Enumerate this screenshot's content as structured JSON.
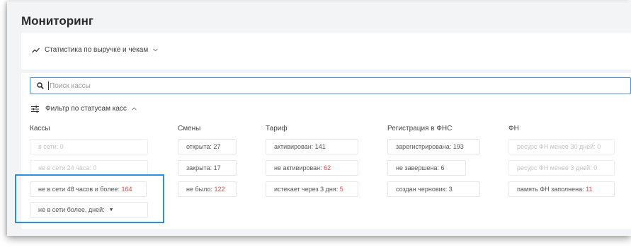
{
  "page": {
    "title": "Мониторинг"
  },
  "stats": {
    "label": "Статистика по выручке и чекам"
  },
  "search": {
    "placeholder": "Поиск кассы"
  },
  "filter": {
    "label": "Фильтр по статусам касс"
  },
  "columns": {
    "kassy": {
      "title": "Кассы",
      "online": {
        "label": "в сети:",
        "value": "0"
      },
      "offline24": {
        "label": "не в сети 24 часа:",
        "value": "0"
      },
      "offline48": {
        "label": "не в сети 48 часов и более:",
        "value": "164"
      },
      "offlineDays": {
        "label": "не в сети более, дней:"
      }
    },
    "smeny": {
      "title": "Смены",
      "opened": {
        "label": "открыта:",
        "value": "27"
      },
      "closed": {
        "label": "закрыта:",
        "value": "17"
      },
      "none": {
        "label": "не было:",
        "value": "122"
      }
    },
    "tarif": {
      "title": "Тариф",
      "active": {
        "label": "активирован:",
        "value": "141"
      },
      "inactive": {
        "label": "не активирован:",
        "value": "62"
      },
      "expiring": {
        "label": "истекает через 3 дня:",
        "value": "5"
      }
    },
    "fns": {
      "title": "Регистрация в ФНС",
      "registered": {
        "label": "зарегистрирована:",
        "value": "193"
      },
      "incomplete": {
        "label": "не завершена:",
        "value": "6"
      },
      "draft": {
        "label": "создан черновик:",
        "value": "3"
      }
    },
    "fn": {
      "title": "ФН",
      "resource30": {
        "label": "ресурс ФН менее 30 дней:",
        "value": "0"
      },
      "resource3": {
        "label": "ресурс ФН менее 3 дней:",
        "value": "0"
      },
      "full": {
        "label": "память ФН заполнена:",
        "value": "11"
      }
    }
  },
  "colors": {
    "accent": "#4a90e2",
    "highlight": "#2a8fdc",
    "alert": "#e04848",
    "background": "#f3f4f6"
  }
}
